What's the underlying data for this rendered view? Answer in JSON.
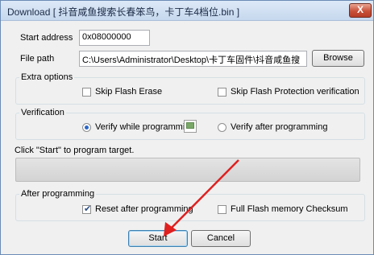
{
  "window": {
    "title": "Download [ 抖音咸鱼搜索长春笨鸟，卡丁车4档位.bin ]",
    "close_glyph": "X"
  },
  "start_address": {
    "label": "Start address",
    "value": "0x08000000"
  },
  "file_path": {
    "label": "File path",
    "value": "C:\\Users\\Administrator\\Desktop\\卡丁车固件\\抖音咸鱼搜",
    "browse_label": "Browse"
  },
  "extra_options": {
    "title": "Extra options",
    "skip_flash_erase": {
      "label": "Skip Flash Erase",
      "checked": false
    },
    "skip_flash_protection": {
      "label": "Skip Flash Protection verification",
      "checked": false
    }
  },
  "verification": {
    "title": "Verification",
    "verify_while": {
      "label": "Verify while programmin",
      "selected": true
    },
    "verify_after": {
      "label": "Verify after programming",
      "selected": false
    }
  },
  "status": {
    "text": "Click \"Start\" to program target."
  },
  "progress": {
    "fraction": 0
  },
  "after_programming": {
    "title": "After programming",
    "reset_after": {
      "label": "Reset after programming",
      "checked": true
    },
    "full_checksum": {
      "label": "Full Flash memory Checksum",
      "checked": false
    }
  },
  "buttons": {
    "start_label": "Start",
    "cancel_label": "Cancel"
  },
  "colors": {
    "annotation_arrow": "#e01f1f",
    "radio_dot": "#2a67c9"
  },
  "icons": {
    "close": "close-icon",
    "broken_image": "broken-image-icon",
    "arrow": "red-arrow-annotation"
  }
}
